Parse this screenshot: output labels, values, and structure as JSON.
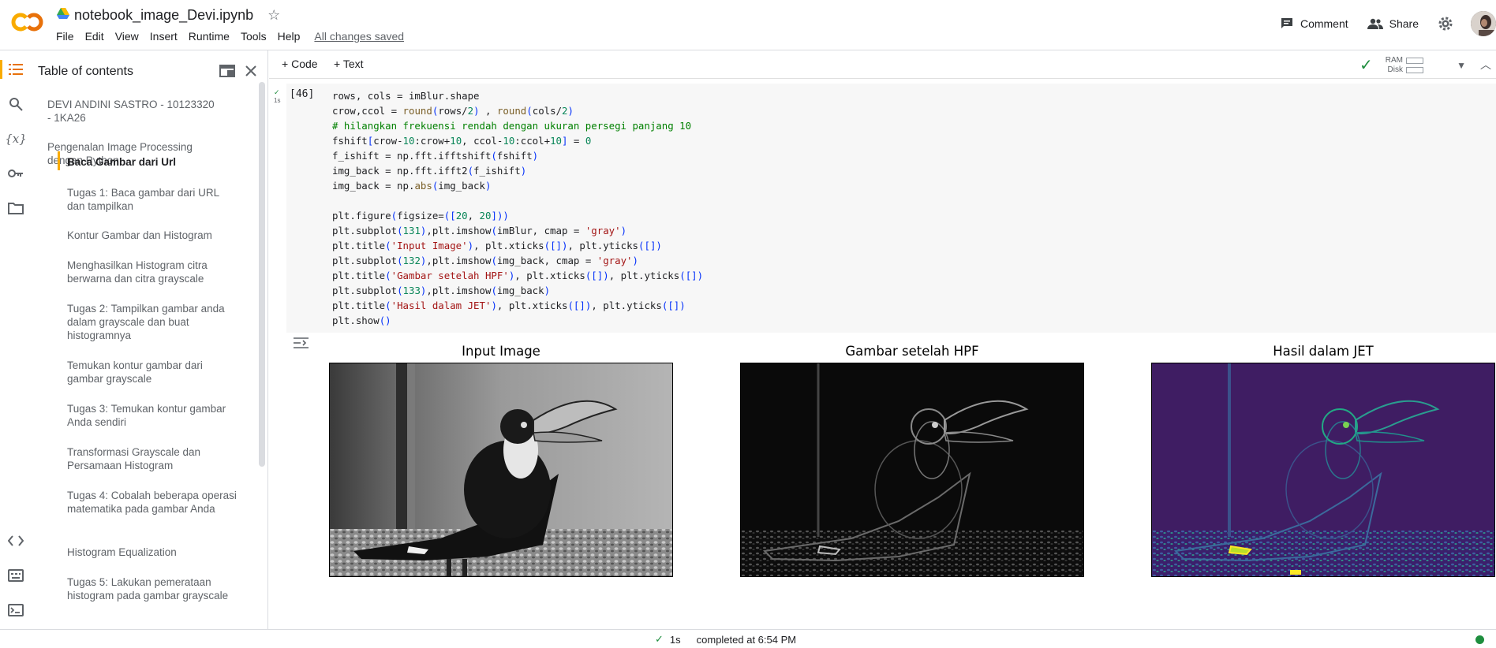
{
  "header": {
    "notebook_title": "notebook_image_Devi.ipynb",
    "menu": [
      "File",
      "Edit",
      "View",
      "Insert",
      "Runtime",
      "Tools",
      "Help"
    ],
    "save_status": "All changes saved",
    "comment_label": "Comment",
    "share_label": "Share"
  },
  "toc": {
    "title": "Table of contents",
    "items": [
      "DEVI ANDINI SASTRO - 10123320 - 1KA26",
      "Pengenalan Image Processing dengan Python",
      "Baca Gambar dari Url",
      "Tugas 1: Baca gambar dari URL dan tampilkan",
      "Kontur Gambar dan Histogram",
      "Menghasilkan Histogram citra berwarna dan citra grayscale",
      "Tugas 2: Tampilkan gambar anda dalam grayscale dan buat histogramnya",
      "Temukan kontur gambar dari gambar grayscale",
      "Tugas 3: Temukan kontur gambar Anda sendiri",
      "Transformasi Grayscale dan Persamaan Histogram",
      "Tugas 4: Cobalah beberapa operasi matematika pada gambar Anda",
      "Histogram Equalization",
      "Tugas 5: Lakukan pemerataan histogram pada gambar grayscale"
    ]
  },
  "toolbar": {
    "code_label": "Code",
    "text_label": "Text",
    "ram_label": "RAM",
    "disk_label": "Disk"
  },
  "cell": {
    "exec_count": "[46]",
    "exec_time": "1s",
    "code_lines": [
      "rows, cols = imBlur.shape",
      "crow,ccol = round(rows/2) , round(cols/2)",
      "# hilangkan frekuensi rendah dengan ukuran persegi panjang 10",
      "fshift[crow-10:crow+10, ccol-10:ccol+10] = 0",
      "f_ishift = np.fft.ifftshift(fshift)",
      "img_back = np.fft.ifft2(f_ishift)",
      "img_back = np.abs(img_back)",
      "",
      "plt.figure(figsize=([20, 20]))",
      "plt.subplot(131),plt.imshow(imBlur, cmap = 'gray')",
      "plt.title('Input Image'), plt.xticks([]), plt.yticks([])",
      "plt.subplot(132),plt.imshow(img_back, cmap = 'gray')",
      "plt.title('Gambar setelah HPF'), plt.xticks([]), plt.yticks([])",
      "plt.subplot(133),plt.imshow(img_back)",
      "plt.title('Hasil dalam JET'), plt.xticks([]), plt.yticks([])",
      "plt.show()"
    ]
  },
  "output": {
    "plots": [
      {
        "title": "Input Image"
      },
      {
        "title": "Gambar setelah HPF"
      },
      {
        "title": "Hasil dalam JET"
      }
    ]
  },
  "status": {
    "duration": "1s",
    "completed": "completed at 6:54 PM"
  },
  "colors": {
    "accent": "#f9ab00",
    "success": "#1e8e3e"
  }
}
